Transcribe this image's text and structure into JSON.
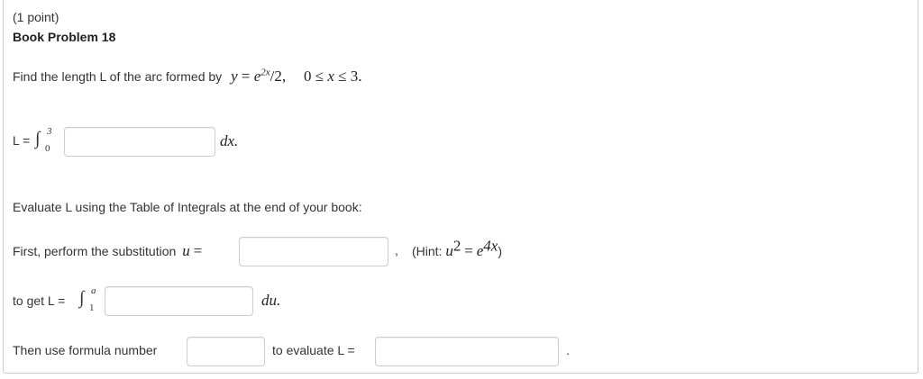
{
  "problem": {
    "points": "(1 point)",
    "title": "Book Problem 18"
  },
  "question": {
    "prompt": "Find the length L of the arc formed by",
    "curve_y": "y",
    "curve_eq": "=",
    "curve_base": "e",
    "curve_exp": "2x",
    "curve_rest": "/2,",
    "domain_lo": "0",
    "domain_le1": "≤",
    "domain_var": "x",
    "domain_le2": "≤",
    "domain_hi": "3."
  },
  "length_integral": {
    "label": "L =",
    "upper": "3",
    "lower": "0",
    "value": "",
    "differential": "dx."
  },
  "evaluate": {
    "instruction": "Evaluate L using the Table of Integrals at the end of your book:"
  },
  "substitution": {
    "label": "First, perform the substitution",
    "var": "u",
    "eq": "=",
    "value": "",
    "comma": ",",
    "hint_open": "(Hint:",
    "hint_u": "u",
    "hint_u_exp": "2",
    "hint_eq": "=",
    "hint_base": "e",
    "hint_exp": "4x",
    "hint_close": ")"
  },
  "u_integral": {
    "label": "to get L =",
    "upper": "a",
    "lower": "1",
    "value": "",
    "differential": "du."
  },
  "formula": {
    "label": "Then use formula number",
    "value": "",
    "evaluate_label": "to evaluate L =",
    "answer_value": "",
    "period": "."
  }
}
